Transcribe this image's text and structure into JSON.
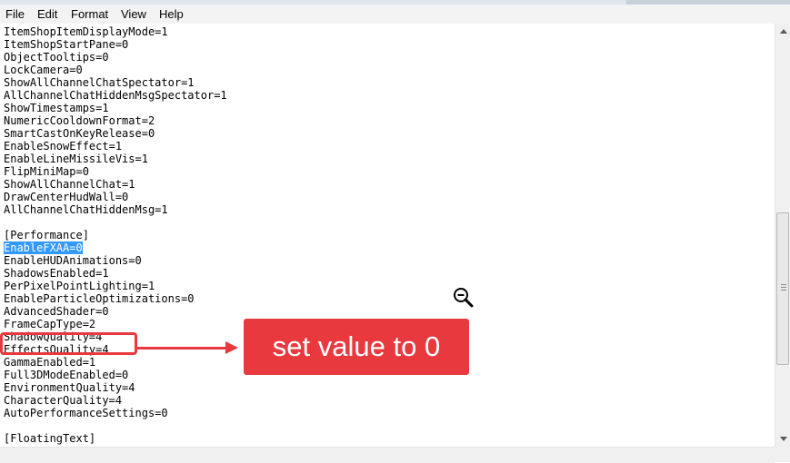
{
  "menu": {
    "items": [
      "File",
      "Edit",
      "Format",
      "View",
      "Help"
    ]
  },
  "editor": {
    "lines": [
      "ItemShopItemDisplayMode=1",
      "ItemShopStartPane=0",
      "ObjectTooltips=0",
      "LockCamera=0",
      "ShowAllChannelChatSpectator=1",
      "AllChannelChatHiddenMsgSpectator=1",
      "ShowTimestamps=1",
      "NumericCooldownFormat=2",
      "SmartCastOnKeyRelease=0",
      "EnableSnowEffect=1",
      "EnableLineMissileVis=1",
      "FlipMiniMap=0",
      "ShowAllChannelChat=1",
      "DrawCenterHudWall=0",
      "AllChannelChatHiddenMsg=1",
      "",
      "[Performance]",
      "EnableFXAA=0",
      "EnableHUDAnimations=0",
      "ShadowsEnabled=1",
      "PerPixelPointLighting=1",
      "EnableParticleOptimizations=0",
      "AdvancedShader=0",
      "FrameCapType=2",
      "ShadowQuality=4",
      "EffectsQuality=4",
      "GammaEnabled=1",
      "Full3DModeEnabled=0",
      "EnvironmentQuality=4",
      "CharacterQuality=4",
      "AutoPerformanceSettings=0",
      "",
      "[FloatingText]"
    ],
    "selected_line": "EnableFXAA=0"
  },
  "annotation": {
    "callout_text": "set value to 0",
    "highlight_line": "EffectsQuality=4",
    "color": "#e8393f"
  },
  "icons": {
    "cursor": "zoom-out-magnifier-icon",
    "scroll_up": "arrow-up-icon",
    "scroll_down": "arrow-down-icon"
  }
}
